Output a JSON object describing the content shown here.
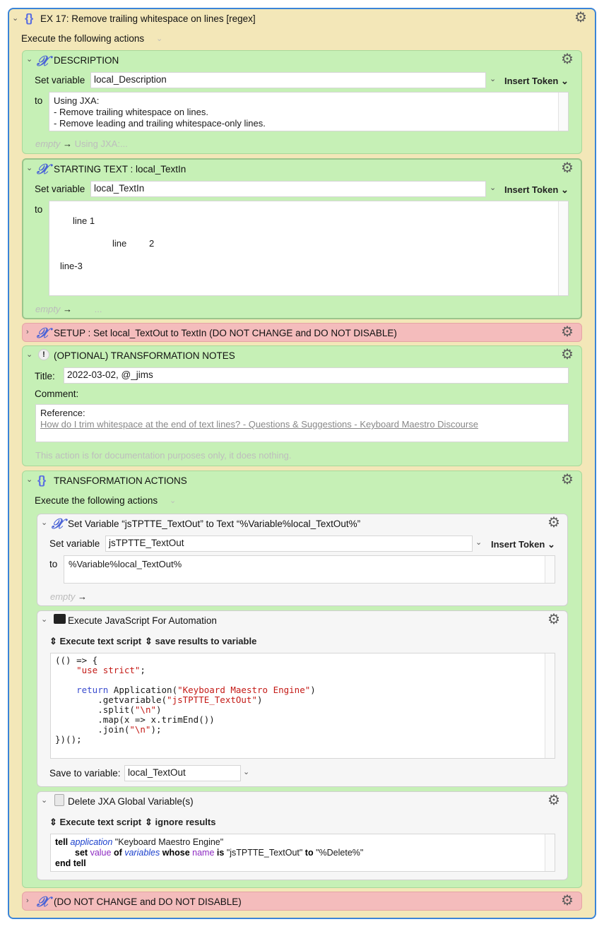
{
  "macro": {
    "title": "EX 17: Remove trailing whitespace on lines [regex]",
    "execute_label": "Execute the following actions"
  },
  "description": {
    "title": "DESCRIPTION",
    "set_variable_label": "Set variable",
    "variable": "local_Description",
    "insert_token": "Insert Token",
    "to_label": "to",
    "value_lines": [
      "Using JXA:",
      "- Remove trailing whitespace on lines.",
      "- Remove leading and trailing whitespace-only lines."
    ],
    "preview_empty": "empty",
    "preview_arrow": "→",
    "preview_value": "Using JXA:..."
  },
  "starting_text": {
    "title": "STARTING TEXT : local_TextIn",
    "set_variable_label": "Set variable",
    "variable": "local_TextIn",
    "insert_token": "Insert Token",
    "to_label": "to",
    "line1": "line 1",
    "line2a": "line",
    "line2b": "2",
    "line3": "line-3",
    "preview_empty": "empty",
    "preview_arrow": "→",
    "preview_value": "..."
  },
  "setup": {
    "title": "SETUP : Set local_TextOut to TextIn (DO NOT CHANGE and DO NOT DISABLE)"
  },
  "notes": {
    "title": "(OPTIONAL) TRANSFORMATION NOTES",
    "title_label": "Title:",
    "title_value": "2022-03-02, @_jims",
    "comment_label": "Comment:",
    "reference_label": "Reference:",
    "reference_link": "How do I trim whitespace at the end of text lines? - Questions & Suggestions - Keyboard Maestro Discourse",
    "footer": "This action is for documentation purposes only, it does nothing."
  },
  "transform": {
    "title": "TRANSFORMATION ACTIONS",
    "execute_label": "Execute the following actions",
    "set_var_action": {
      "title": "Set Variable “jsTPTTE_TextOut” to Text “%Variable%local_TextOut%”",
      "set_variable_label": "Set variable",
      "variable": "jsTPTTE_TextOut",
      "insert_token": "Insert Token",
      "to_label": "to",
      "value": "%Variable%local_TextOut%",
      "preview_empty": "empty",
      "preview_arrow": "→"
    },
    "jxa_action": {
      "title": "Execute JavaScript For Automation",
      "mode": "Execute text script",
      "result_mode": "save results to variable",
      "save_label": "Save to variable:",
      "save_variable": "local_TextOut"
    },
    "delete_action": {
      "title": "Delete JXA Global Variable(s)",
      "mode": "Execute text script",
      "result_mode": "ignore results"
    }
  },
  "final": {
    "title": "(DO NOT CHANGE and DO NOT DISABLE)"
  },
  "icons": {
    "gear": "⚙",
    "x": "𝒳",
    "braces": "{}",
    "chevron_down": "⌄",
    "chevron_right": "›",
    "updown": "⌃"
  }
}
